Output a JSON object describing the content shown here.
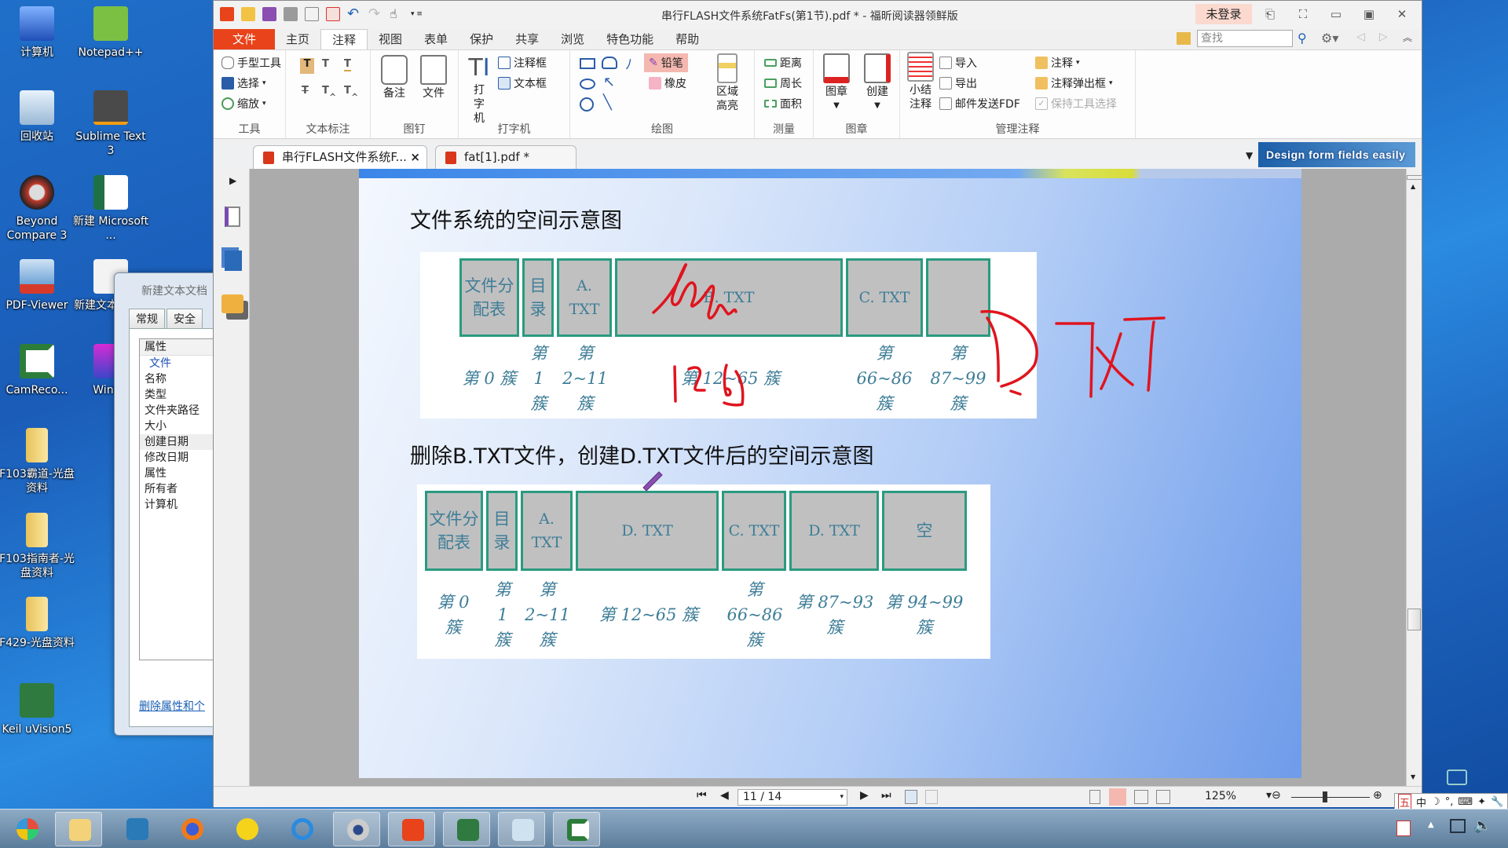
{
  "desktop": {
    "icons": [
      {
        "label": "计算机"
      },
      {
        "label": "Notepad++"
      },
      {
        "label": "回收站"
      },
      {
        "label": "Sublime Text 3"
      },
      {
        "label": "Beyond Compare 3"
      },
      {
        "label": "新建 Microsoft ..."
      },
      {
        "label": "PDF-Viewer"
      },
      {
        "label": "新建文本文档.t"
      },
      {
        "label": "CamReco..."
      },
      {
        "label": "WinHe"
      },
      {
        "label": "F103霸道-光盘资料"
      },
      {
        "label": "F103指南者-光盘资料"
      },
      {
        "label": "F429-光盘资料"
      },
      {
        "label": "Keil uVision5"
      }
    ]
  },
  "properties_window": {
    "title": "新建文本文档",
    "tabs": [
      "常规",
      "安全"
    ],
    "header": "属性",
    "section": "文件",
    "items": [
      "名称",
      "类型",
      "文件夹路径",
      "大小",
      "创建日期",
      "修改日期",
      "属性",
      "所有者",
      "计算机"
    ],
    "link": "删除属性和个"
  },
  "app": {
    "title": "串行FLASH文件系统FatFs(第1节).pdf * - 福昕阅读器领鲜版",
    "login": "未登录",
    "menu_tabs": [
      "文件",
      "主页",
      "注释",
      "视图",
      "表单",
      "保护",
      "共享",
      "浏览",
      "特色功能",
      "帮助"
    ],
    "active_tab": "注释",
    "search_placeholder": "查找",
    "ribbon": {
      "tools": {
        "label": "工具",
        "items": [
          "手型工具",
          "选择",
          "缩放"
        ]
      },
      "text_markup": {
        "label": "文本标注"
      },
      "pin": {
        "label": "图钉",
        "items": [
          "备注",
          "文件"
        ]
      },
      "typewriter": {
        "label": "打字机",
        "big": "打字机",
        "items": [
          "注释框",
          "文本框"
        ]
      },
      "drawing": {
        "label": "绘图",
        "items": [
          "铅笔",
          "橡皮"
        ],
        "area_highlight": "区域高亮"
      },
      "measure": {
        "label": "测量",
        "items": [
          "距离",
          "周长",
          "面积"
        ]
      },
      "stamp": {
        "label": "图章",
        "items": [
          "图章",
          "创建"
        ]
      },
      "manage": {
        "label": "管理注释",
        "summary": "小结注释",
        "items": [
          "导入",
          "导出",
          "邮件发送FDF",
          "注释",
          "注释弹出框",
          "保持工具选择"
        ]
      }
    },
    "doc_tabs": [
      {
        "label": "串行FLASH文件系统F...",
        "active": true
      },
      {
        "label": "fat[1].pdf *",
        "active": false
      }
    ],
    "ad_banner": "Design form fields easily",
    "status": {
      "page": "11 / 14",
      "zoom": "125%"
    }
  },
  "document": {
    "diagram1": {
      "title": "文件系统的空间示意图",
      "blocks": [
        "文件分配表",
        "目录",
        "A. TXT",
        "B. TXT",
        "C. TXT",
        ""
      ],
      "labels": [
        "第 0 簇",
        "第 1 簇",
        "第 2~11 簇",
        "第 12~65 簇",
        "第 66~86 簇",
        "第 87~99 簇"
      ],
      "handwriting": [
        "12~65 (scribble over B.TXT)",
        "D.TXT"
      ]
    },
    "diagram2": {
      "title": "删除B.TXT文件，创建D.TXT文件后的空间示意图",
      "blocks": [
        "文件分配表",
        "目录",
        "A. TXT",
        "D. TXT",
        "C. TXT",
        "D. TXT",
        "空"
      ],
      "labels": [
        "第 0 簇",
        "第 1 簇",
        "第 2~11 簇",
        "第 12~65 簇",
        "第 66~86 簇",
        "第 87~93 簇",
        "第 94~99 簇"
      ]
    },
    "ink_color": "#e0141e"
  },
  "taskbar": {
    "items": [
      "start",
      "explorer",
      "powershell",
      "firefox",
      "qq-music",
      "browser",
      "webcam",
      "foxit-reader",
      "keil",
      "notepad",
      "camtasia"
    ]
  },
  "ime": {
    "items": [
      "五",
      "中",
      "☽",
      "°,",
      "⌨",
      "✦",
      "🔧"
    ]
  }
}
